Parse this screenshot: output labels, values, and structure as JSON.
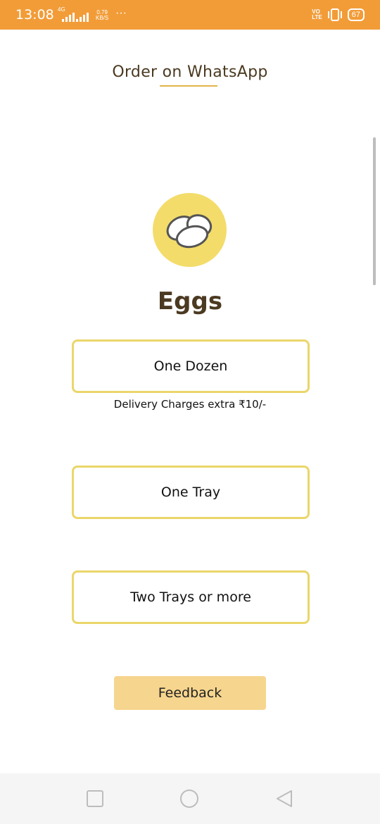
{
  "status_bar": {
    "time": "13:08",
    "network_label": "4G",
    "speed_value": "0.79",
    "speed_unit": "KB/S",
    "more": "···",
    "volte_top": "VO",
    "volte_bottom": "LTE",
    "battery": "67",
    "color": "#f29c38"
  },
  "header": {
    "title": "Order on WhatsApp"
  },
  "product": {
    "icon": "eggs-icon",
    "name": "Eggs",
    "icon_bg": "#f3dc6a"
  },
  "options": [
    {
      "label": "One Dozen"
    },
    {
      "label": "One Tray"
    },
    {
      "label": "Two Trays or more"
    }
  ],
  "delivery_note": "Delivery Charges extra ₹10/-",
  "feedback_button": {
    "label": "Feedback",
    "color": "#f6d58e"
  },
  "nav": {
    "icons": [
      "recents-square-icon",
      "home-circle-icon",
      "back-triangle-icon"
    ]
  }
}
